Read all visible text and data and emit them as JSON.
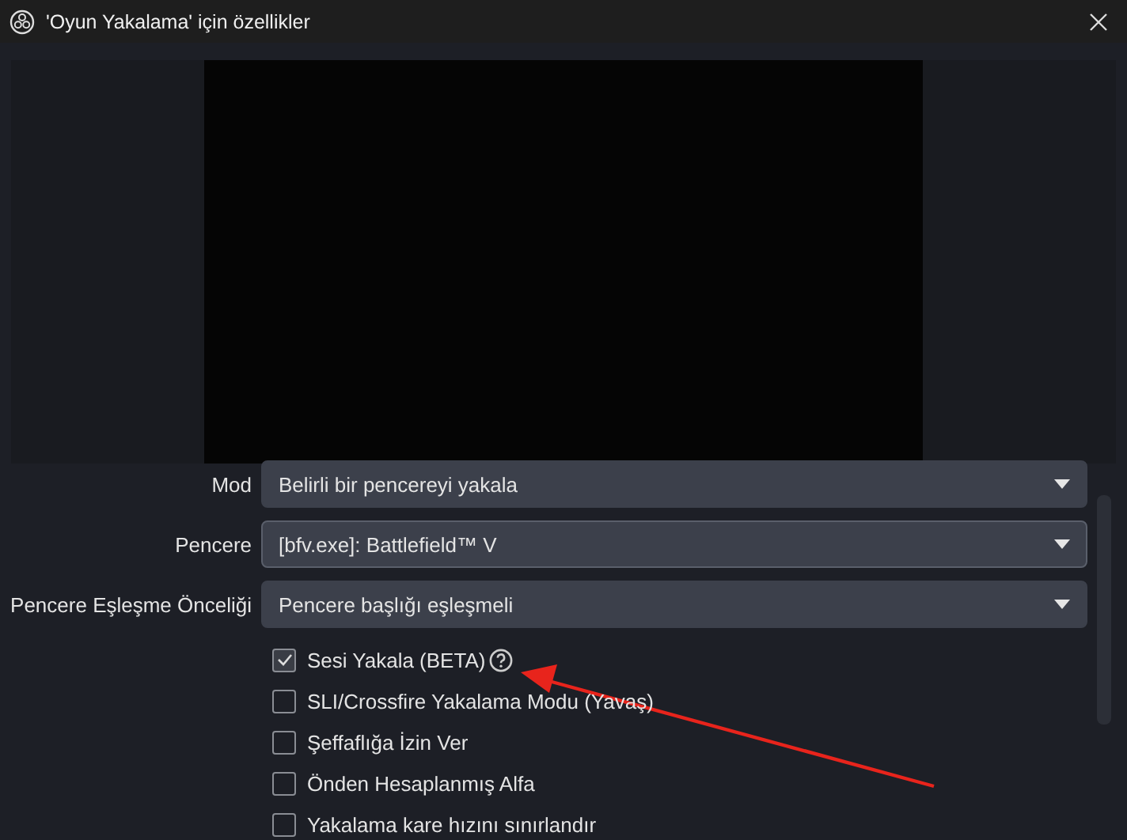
{
  "window": {
    "title": "'Oyun Yakalama' için özellikler"
  },
  "fields": [
    {
      "label": "Mod",
      "value": "Belirli bir pencereyi yakala",
      "focused": false
    },
    {
      "label": "Pencere",
      "value": "[bfv.exe]: Battlefield™ V",
      "focused": true
    },
    {
      "label": "Pencere Eşleşme Önceliği",
      "value": "Pencere başlığı eşleşmeli",
      "focused": false
    }
  ],
  "options": [
    {
      "label": "Sesi Yakala (BETA)",
      "checked": true,
      "help": true
    },
    {
      "label": "SLI/Crossfire Yakalama Modu (Yavaş)",
      "checked": false,
      "help": false
    },
    {
      "label": "Şeffaflığa İzin Ver",
      "checked": false,
      "help": false
    },
    {
      "label": "Önden Hesaplanmış Alfa",
      "checked": false,
      "help": false
    },
    {
      "label": "Yakalama kare hızını sınırlandır",
      "checked": false,
      "help": false
    }
  ]
}
